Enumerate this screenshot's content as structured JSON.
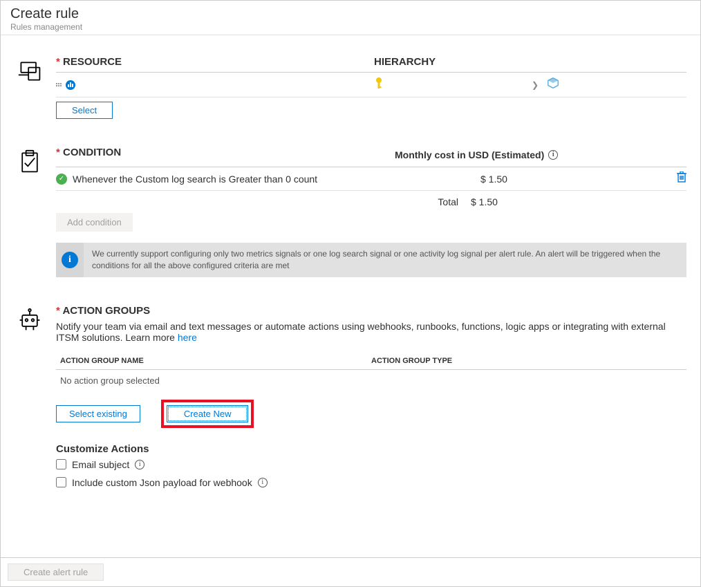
{
  "header": {
    "title": "Create rule",
    "subtitle": "Rules management"
  },
  "resource": {
    "heading": "RESOURCE",
    "hierarchy_heading": "HIERARCHY",
    "select_label": "Select"
  },
  "condition": {
    "heading": "CONDITION",
    "cost_heading": "Monthly cost in USD (Estimated)",
    "items": [
      {
        "text": "Whenever the Custom log search is Greater than 0 count",
        "cost": "$ 1.50"
      }
    ],
    "total_label": "Total",
    "total_value": "$ 1.50",
    "add_label": "Add condition",
    "info_text": "We currently support configuring only two metrics signals or one log search signal or one activity log signal per alert rule. An alert will be triggered when the conditions for all the above configured criteria are met"
  },
  "action_groups": {
    "heading": "ACTION GROUPS",
    "description": "Notify your team via email and text messages or automate actions using webhooks, runbooks, functions, logic apps or integrating with external ITSM solutions. Learn more ",
    "learn_more": "here",
    "col_name": "ACTION GROUP NAME",
    "col_type": "ACTION GROUP TYPE",
    "empty_text": "No action group selected",
    "select_existing": "Select existing",
    "create_new": "Create New",
    "customize_title": "Customize Actions",
    "email_subject": "Email subject",
    "json_payload": "Include custom Json payload for webhook"
  },
  "footer": {
    "create_label": "Create alert rule"
  }
}
